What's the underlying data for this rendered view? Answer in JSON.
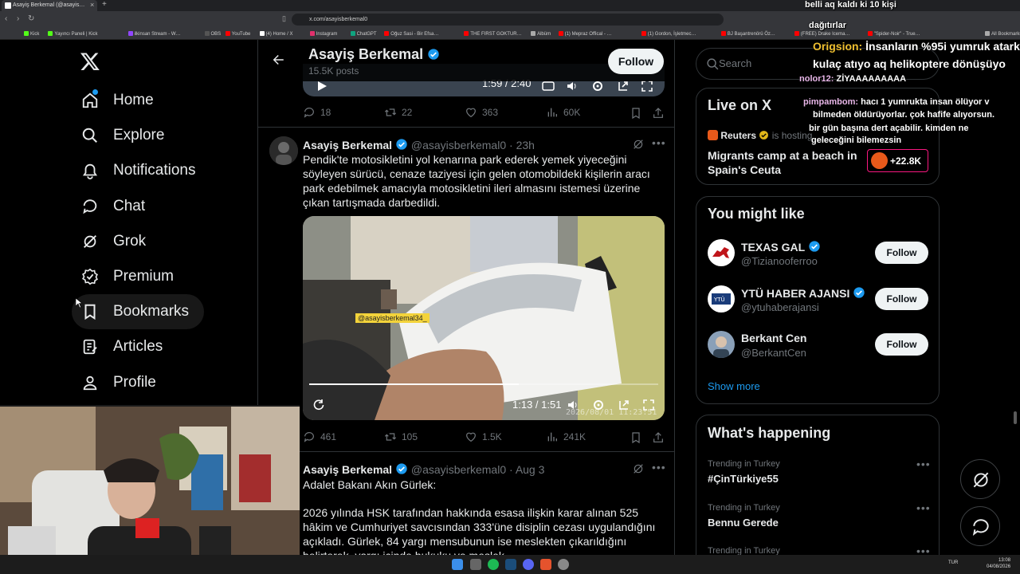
{
  "browser": {
    "tab_title": "Asayiş Berkemal (@asayis…",
    "url": "x.com/asayisberkemal0",
    "bookmarks": [
      "Kick",
      "Yayıncı Paneli | Kick",
      "ilkinsan Stream - W…",
      "OBS",
      "YouTube",
      "(4) Home / X",
      "Instagram",
      "ChatGPT",
      "Oğuz Sasi - Bir Efsa…",
      "THE FIRST GOKTUR…",
      "Albüm",
      "(1) Mepraz Offical - …",
      "(1) Gordon, İşletmec…",
      "BJ Başantrenörü Öz…",
      "(FREE) Drake Icema…",
      "\"Spider-Noir\" - True…",
      "All Bookmarks"
    ]
  },
  "sidebar": {
    "items": [
      {
        "label": "Home",
        "icon": "home-icon"
      },
      {
        "label": "Explore",
        "icon": "search-icon"
      },
      {
        "label": "Notifications",
        "icon": "bell-icon"
      },
      {
        "label": "Chat",
        "icon": "chat-icon"
      },
      {
        "label": "Grok",
        "icon": "grok-icon"
      },
      {
        "label": "Premium",
        "icon": "premium-icon"
      },
      {
        "label": "Bookmarks",
        "icon": "bookmark-icon"
      },
      {
        "label": "Articles",
        "icon": "articles-icon"
      },
      {
        "label": "Profile",
        "icon": "profile-icon"
      }
    ]
  },
  "profile": {
    "name": "Asayiş Berkemal",
    "posts": "15.5K posts",
    "follow_label": "Follow"
  },
  "top_video": {
    "time": "1:59 / 2:40"
  },
  "top_actions": {
    "replies": "18",
    "reposts": "22",
    "likes": "363",
    "views": "60K"
  },
  "tweets": [
    {
      "name": "Asayiş Berkemal",
      "handle": "@asayisberkemal0",
      "time": "23h",
      "text": "Pendik'te motosikletini yol kenarına park ederek yemek yiyeceğini söyleyen sürücü, cenaze taziyesi için gelen otomobildeki kişilerin aracı park edebilmek amacıyla motosikletini ileri almasını istemesi üzerine çıkan tartışmada darbedildi.",
      "video": {
        "time": "1:13 / 1:51",
        "watermark": "@asayisberkemal34_",
        "stamp": "2026/08/01  11:23:51",
        "progress": 0.6
      },
      "actions": {
        "replies": "461",
        "reposts": "105",
        "likes": "1.5K",
        "views": "241K"
      }
    },
    {
      "name": "Asayiş Berkemal",
      "handle": "@asayisberkemal0",
      "time": "Aug 3",
      "text_line1": "Adalet Bakanı Akın Gürlek:",
      "text_body": "2026 yılında HSK tarafından hakkında esasa ilişkin karar alınan 525 hâkim ve Cumhuriyet savcısından 333'üne disiplin cezası uygulandığını açıkladı. Gürlek, 84 yargı mensubunun ise meslekten çıkarıldığını belirterek, yargı içinde hukuku ve meslek"
    }
  ],
  "right": {
    "search_placeholder": "Search",
    "live": {
      "title": "Live on X",
      "host": "Reuters",
      "host_suffix": "is hosting",
      "topic": "Migrants camp at a beach in Spain's Ceuta",
      "count": "+22.8K"
    },
    "wtf": {
      "title": "You might like",
      "people": [
        {
          "name": "TEXAS GAL",
          "handle": "@Tizianooferroo",
          "button": "Follow"
        },
        {
          "name": "YTÜ HABER AJANSI",
          "handle": "@ytuhaberajansi",
          "button": "Follow"
        },
        {
          "name": "Berkant Cen",
          "handle": "@BerkantCen",
          "button": "Follow"
        }
      ],
      "show_more": "Show more"
    },
    "trends": {
      "title": "What's happening",
      "items": [
        {
          "context": "Trending in Turkey",
          "name": "#ÇinTürkiye55"
        },
        {
          "context": "Trending in Turkey",
          "name": "Bennu Gerede"
        },
        {
          "context": "Trending in Turkey",
          "name": ""
        }
      ]
    }
  },
  "chat_overlay": {
    "lines": [
      {
        "user": "",
        "msg": "belli aq kaldı ki 10 kişi"
      },
      {
        "user": "",
        "msg": "dağıtırlar"
      },
      {
        "user": "Origsion:",
        "msg": "İnsanların %95i yumruk atark"
      },
      {
        "user": "",
        "msg": "kulaç atıyo aq helikoptere dönüşüyo"
      },
      {
        "user": "nolor12:",
        "msg": "ZİYAAAAAAAAA"
      },
      {
        "user": "pimpambom:",
        "msg": "hacı 1 yumrukta insan ölüyor v"
      },
      {
        "user": "",
        "msg": "bilmeden öldürüyorlar. çok hafife alıyorsun."
      },
      {
        "user": "",
        "msg": "bir gün başına dert açabilir. kimden ne"
      },
      {
        "user": "",
        "msg": "geleceğini bilemezsin"
      }
    ]
  },
  "taskbar": {
    "lang": "TUR",
    "time": "13:08",
    "date": "04/08/2026"
  },
  "colors": {
    "accent": "#1d9bf0",
    "live_border": "#f91880",
    "bg": "#000000"
  }
}
